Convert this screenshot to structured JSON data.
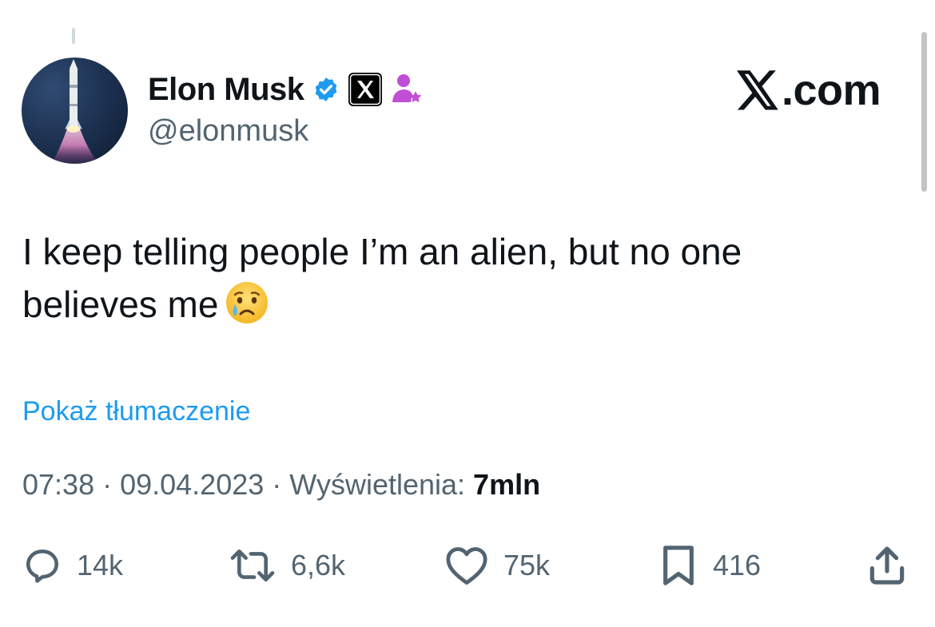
{
  "author": {
    "display_name": "Elon Musk",
    "handle": "@elonmusk",
    "avatar_icon": "rocket-launch-icon"
  },
  "brand": {
    "text": ".com",
    "logo_icon": "x-logo-icon"
  },
  "tweet": {
    "text": "I keep telling people I’m an alien, but no one believes me",
    "emoji_icon": "crying-face-emoji-icon"
  },
  "translate_label": "Pokaż tłumaczenie",
  "meta": {
    "time": "07:38",
    "date": "09.04.2023",
    "separator": " · ",
    "views_label": "Wyświetlenia:",
    "views_count": "7mln"
  },
  "actions": {
    "replies": "14k",
    "reposts": "6,6k",
    "likes": "75k",
    "bookmarks": "416"
  },
  "colors": {
    "link": "#1d9bf0",
    "muted": "#536471",
    "text": "#0f1419",
    "verified": "#1d9bf0",
    "affiliate": "#c04fd6"
  }
}
